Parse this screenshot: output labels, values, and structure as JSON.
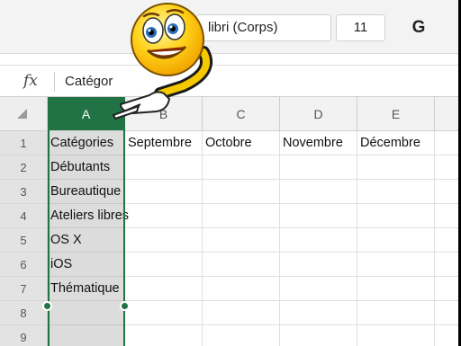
{
  "toolbar": {
    "font_name": "libri (Corps)",
    "font_size": "11",
    "bold_label": "G"
  },
  "formula_bar": {
    "fx_label": "fx",
    "value": "Catégor"
  },
  "columns": [
    "A",
    "B",
    "C",
    "D",
    "E"
  ],
  "rows": [
    "1",
    "2",
    "3",
    "4",
    "5",
    "6",
    "7",
    "8",
    "9"
  ],
  "cells": {
    "A1": "Catégories",
    "B1": "Septembre",
    "C1": "Octobre",
    "D1": "Novembre",
    "E1": "Décembre",
    "A2": "Débutants",
    "A3": "Bureautique",
    "A4": "Ateliers libres",
    "A5": "OS X",
    "A6": "iOS",
    "A7": "Thématique"
  },
  "colors": {
    "accent": "#217346",
    "selected_column_bg": "#dcdcdc"
  }
}
